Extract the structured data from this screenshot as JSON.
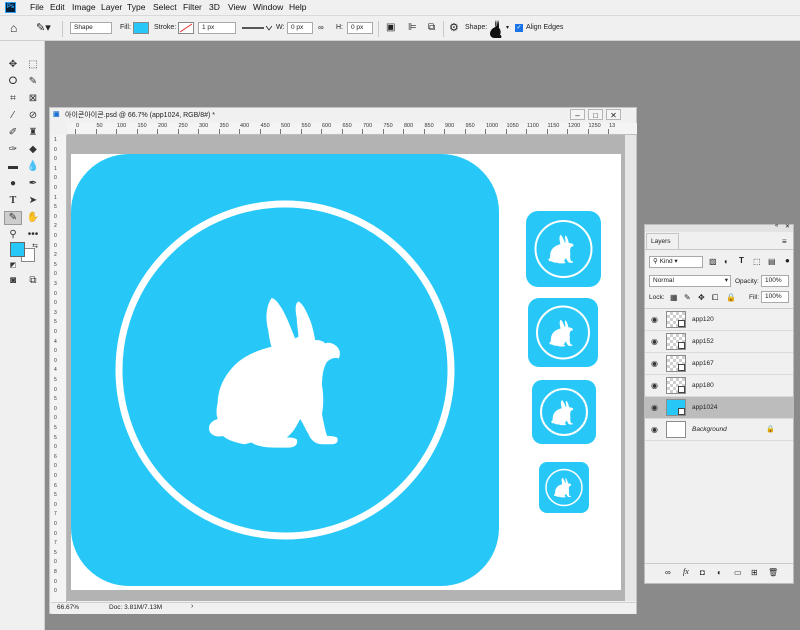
{
  "menubar": {
    "app_icon": "Ps",
    "items": [
      "File",
      "Edit",
      "Image",
      "Layer",
      "Type",
      "Select",
      "Filter",
      "3D",
      "View",
      "Window",
      "Help"
    ]
  },
  "options": {
    "mode": "Shape",
    "fill_label": "Fill:",
    "stroke_label": "Stroke:",
    "stroke_width": "1 px",
    "w_label": "W:",
    "w_value": "0 px",
    "h_label": "H:",
    "h_value": "0 px",
    "shape_label": "Shape:",
    "align_edges": "Align Edges",
    "fill_color": "#27c8f7"
  },
  "document": {
    "title": "아이콘아이콘.psd @ 66.7% (app1024, RGB/8#) *",
    "zoom": "66.67%",
    "doc_info": "Doc: 3.81M/7.13M",
    "ruler_labels": [
      "0",
      "50",
      "100",
      "150",
      "200",
      "250",
      "300",
      "350",
      "400",
      "450",
      "500",
      "550",
      "600",
      "650",
      "700",
      "750",
      "800",
      "850",
      "900",
      "950",
      "1000",
      "1050",
      "1100",
      "1150",
      "1200",
      "1250",
      "13"
    ],
    "vruler_labels": [
      "1",
      "0",
      "0",
      "1",
      "0",
      "0",
      "1",
      "5",
      "0",
      "2",
      "0",
      "0",
      "2",
      "5",
      "0",
      "3",
      "0",
      "0",
      "3",
      "5",
      "0",
      "4",
      "0",
      "0",
      "4",
      "5",
      "0",
      "5",
      "0",
      "0",
      "5",
      "5",
      "0",
      "6",
      "0",
      "0",
      "6",
      "5",
      "0",
      "7",
      "0",
      "0",
      "7",
      "5",
      "0",
      "8",
      "0",
      "0"
    ],
    "icon_color": "#27c8f7"
  },
  "layers_panel": {
    "tab": "Layers",
    "filter_kind": "Kind",
    "blend_mode": "Normal",
    "opacity_label": "Opacity:",
    "opacity_value": "100%",
    "lock_label": "Lock:",
    "fill_label": "Fill:",
    "fill_value": "100%",
    "layers": [
      {
        "name": "app120",
        "type": "smart",
        "selected": false
      },
      {
        "name": "app152",
        "type": "smart",
        "selected": false
      },
      {
        "name": "app167",
        "type": "smart",
        "selected": false
      },
      {
        "name": "app180",
        "type": "smart",
        "selected": false
      },
      {
        "name": "app1024",
        "type": "smart",
        "selected": true
      },
      {
        "name": "Background",
        "type": "background",
        "selected": false
      }
    ],
    "footer_fx": "fx"
  }
}
